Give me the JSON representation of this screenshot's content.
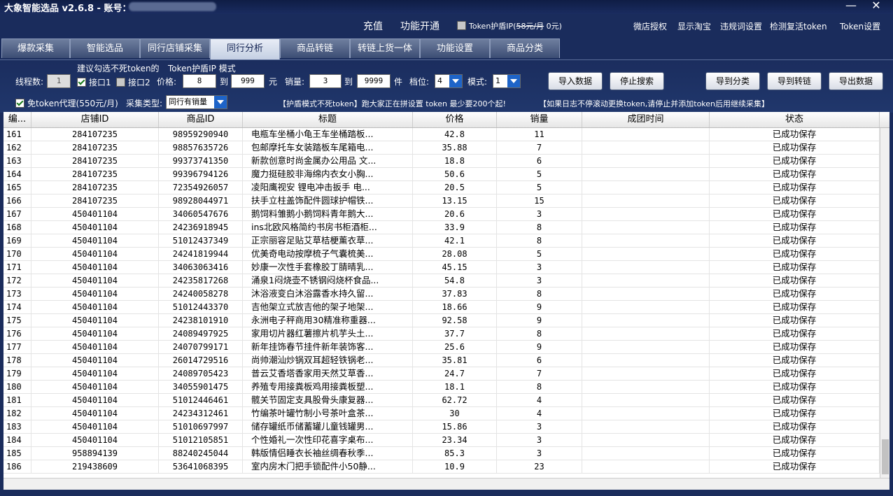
{
  "app": {
    "title": "大象智能选品 v2.6.8  -  账号：",
    "minimize": "—",
    "close": "✕"
  },
  "topbar": {
    "recharge": "充值",
    "activate": "功能开通",
    "token_shield": {
      "prefix": "Token护盾IP(",
      "old_price": "58元/月",
      "suffix": "  0元)"
    },
    "links": [
      "微店授权",
      "显示淘宝",
      "违规词设置",
      "检测复活token",
      "Token设置"
    ]
  },
  "tabs": [
    "爆款采集",
    "智能选品",
    "同行店铺采集",
    "同行分析",
    "商品转链",
    "转链上货一体",
    "功能设置",
    "商品分类"
  ],
  "toolbar": {
    "thread_label": "线程数:",
    "thread_value": "1",
    "suggest_line1": "建议勾选不死token的",
    "suggest_mode": "Token护盾IP  模式",
    "api1": "接口1",
    "api2": "接口2",
    "price_label": "价格:",
    "price_min": "8",
    "to1": "到",
    "price_max": "999",
    "yuan": "元",
    "sales_label": "销量:",
    "sales_min": "3",
    "to2": "到",
    "sales_max": "9999",
    "jian": "件",
    "level_label": "档位:",
    "level_value": "4",
    "mode_label": "模式:",
    "mode_value": "1",
    "proxy_label": "免token代理(550元/月)",
    "collect_type_label": "采集类型:",
    "collect_type_value": "同行有销量",
    "notice1": "【护盾模式不死token】跑大家正在拼设置  token  最少要200个起!",
    "notice2": "【如果日志不停滚动更换token,请停止并添加token后用继续采集】",
    "buttons": {
      "import": "导入数据",
      "stop": "停止搜索",
      "to_category": "导到分类",
      "to_link": "导到转链",
      "export": "导出数据"
    }
  },
  "table": {
    "columns": [
      "编...",
      "店铺ID",
      "商品ID",
      "标题",
      "价格",
      "销量",
      "成团时间",
      "状态"
    ],
    "rows": [
      [
        "161",
        "284107235",
        "98959290940",
        "电瓶车坐桶小龟王车坐桶踏板...",
        "42.8",
        "11",
        "",
        "已成功保存"
      ],
      [
        "162",
        "284107235",
        "98857635726",
        "包邮摩托车女装踏板车尾箱电...",
        "35.88",
        "7",
        "",
        "已成功保存"
      ],
      [
        "163",
        "284107235",
        "99373741350",
        "新款创意时尚金属办公用品 文...",
        "18.8",
        "6",
        "",
        "已成功保存"
      ],
      [
        "164",
        "284107235",
        "99396794126",
        "魔力挺硅胶非海绵内衣女小胸...",
        "50.6",
        "5",
        "",
        "已成功保存"
      ],
      [
        "165",
        "284107235",
        "72354926057",
        "凌阳鹰视安 锂电冲击扳手 电...",
        "20.5",
        "5",
        "",
        "已成功保存"
      ],
      [
        "166",
        "284107235",
        "98928044971",
        "扶手立柱盖饰配件圆球护帽铁...",
        "13.15",
        "15",
        "",
        "已成功保存"
      ],
      [
        "167",
        "450401104",
        "34060547676",
        "鹅饲料雏鹅小鹅饲料青年鹅大...",
        "20.6",
        "3",
        "",
        "已成功保存"
      ],
      [
        "168",
        "450401104",
        "24236918945",
        "ins北欧风格简约书房书柜酒柜...",
        "33.9",
        "8",
        "",
        "已成功保存"
      ],
      [
        "169",
        "450401104",
        "51012437349",
        "正宗丽容足贴艾草桔梗薰衣草...",
        "42.1",
        "8",
        "",
        "已成功保存"
      ],
      [
        "170",
        "450401104",
        "24241819944",
        "优美奇电动按摩梳子气囊梳美...",
        "28.08",
        "5",
        "",
        "已成功保存"
      ],
      [
        "171",
        "450401104",
        "34063063416",
        "妙康一次性手套橡胶丁腈晴乳...",
        "45.15",
        "3",
        "",
        "已成功保存"
      ],
      [
        "172",
        "450401104",
        "24235817268",
        "涌泉1闷烧壶不锈钢闷烧杯食品...",
        "54.8",
        "3",
        "",
        "已成功保存"
      ],
      [
        "173",
        "450401104",
        "24240058278",
        "沐浴液变白沐浴露香水持久留...",
        "37.83",
        "8",
        "",
        "已成功保存"
      ],
      [
        "174",
        "450401104",
        "51012443370",
        "吉他架立式放吉他的架子地架...",
        "18.66",
        "9",
        "",
        "已成功保存"
      ],
      [
        "175",
        "450401104",
        "24238101910",
        "永洲电子秤商用30精准称重器...",
        "92.58",
        "9",
        "",
        "已成功保存"
      ],
      [
        "176",
        "450401104",
        "24089497925",
        "家用切片器红薯擦片机芋头土...",
        "37.7",
        "8",
        "",
        "已成功保存"
      ],
      [
        "177",
        "450401104",
        "24070799171",
        "新年挂饰春节挂件新年装饰客...",
        "25.6",
        "9",
        "",
        "已成功保存"
      ],
      [
        "178",
        "450401104",
        "26014729516",
        "尚帅潮汕炒锅双耳超轻铁锅老...",
        "35.81",
        "6",
        "",
        "已成功保存"
      ],
      [
        "179",
        "450401104",
        "24089705423",
        "普云艾香塔香家用天然艾草香...",
        "24.7",
        "7",
        "",
        "已成功保存"
      ],
      [
        "180",
        "450401104",
        "34055901475",
        "养殖专用接粪板鸡用接粪板塑...",
        "18.1",
        "8",
        "",
        "已成功保存"
      ],
      [
        "181",
        "450401104",
        "51012446461",
        "髋关节固定支具股骨头康复器...",
        "62.72",
        "4",
        "",
        "已成功保存"
      ],
      [
        "182",
        "450401104",
        "24234312461",
        "竹编茶叶罐竹制小号茶叶盒茶...",
        "30",
        "4",
        "",
        "已成功保存"
      ],
      [
        "183",
        "450401104",
        "51010697997",
        "储存罐纸币储蓄罐儿童钱罐男...",
        "15.86",
        "3",
        "",
        "已成功保存"
      ],
      [
        "184",
        "450401104",
        "51012105851",
        "个性婚礼一次性印花喜字桌布...",
        "23.34",
        "3",
        "",
        "已成功保存"
      ],
      [
        "185",
        "958894139",
        "88240245044",
        "韩版情侣睡衣长袖丝绸春秋季...",
        "85.3",
        "3",
        "",
        "已成功保存"
      ],
      [
        "186",
        "219438609",
        "53641068395",
        "室内房木门把手锁配件小50静...",
        "10.9",
        "23",
        "",
        "已成功保存"
      ]
    ]
  }
}
